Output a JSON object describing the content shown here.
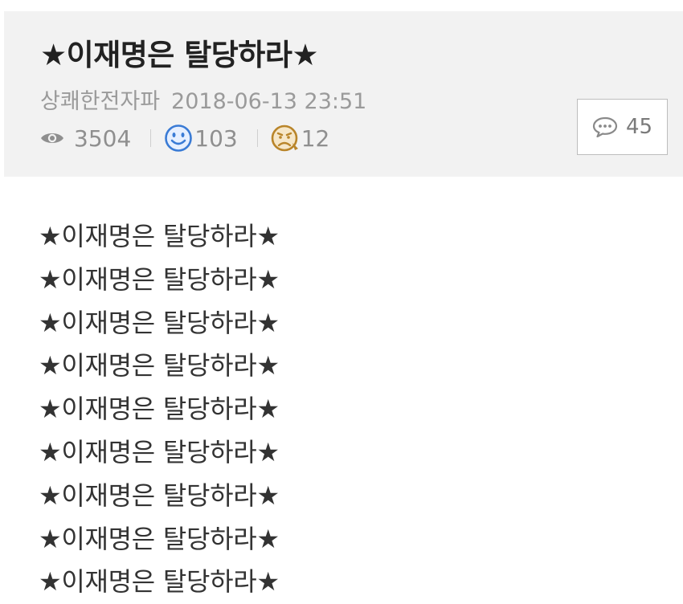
{
  "post": {
    "title": "★이재명은 탈당하라★",
    "author": "상쾌한전자파",
    "date": "2018-06-13 23:51",
    "stats": {
      "views": "3504",
      "likes": "103",
      "dislikes": "12"
    },
    "comments_count": "45",
    "body_lines": [
      "★이재명은 탈당하라★",
      "★이재명은 탈당하라★",
      "★이재명은 탈당하라★",
      "★이재명은 탈당하라★",
      "★이재명은 탈당하라★",
      "★이재명은 탈당하라★",
      "★이재명은 탈당하라★",
      "★이재명은 탈당하라★",
      "★이재명은 탈당하라★"
    ]
  },
  "icons": {
    "views": "eye-icon",
    "likes": "smile-icon",
    "dislikes": "upset-face-icon",
    "comments": "speech-bubble-icon"
  },
  "colors": {
    "header_bg": "#f2f2f2",
    "like_icon": "#3a7bd5",
    "dislike_icon": "#b9852a"
  }
}
